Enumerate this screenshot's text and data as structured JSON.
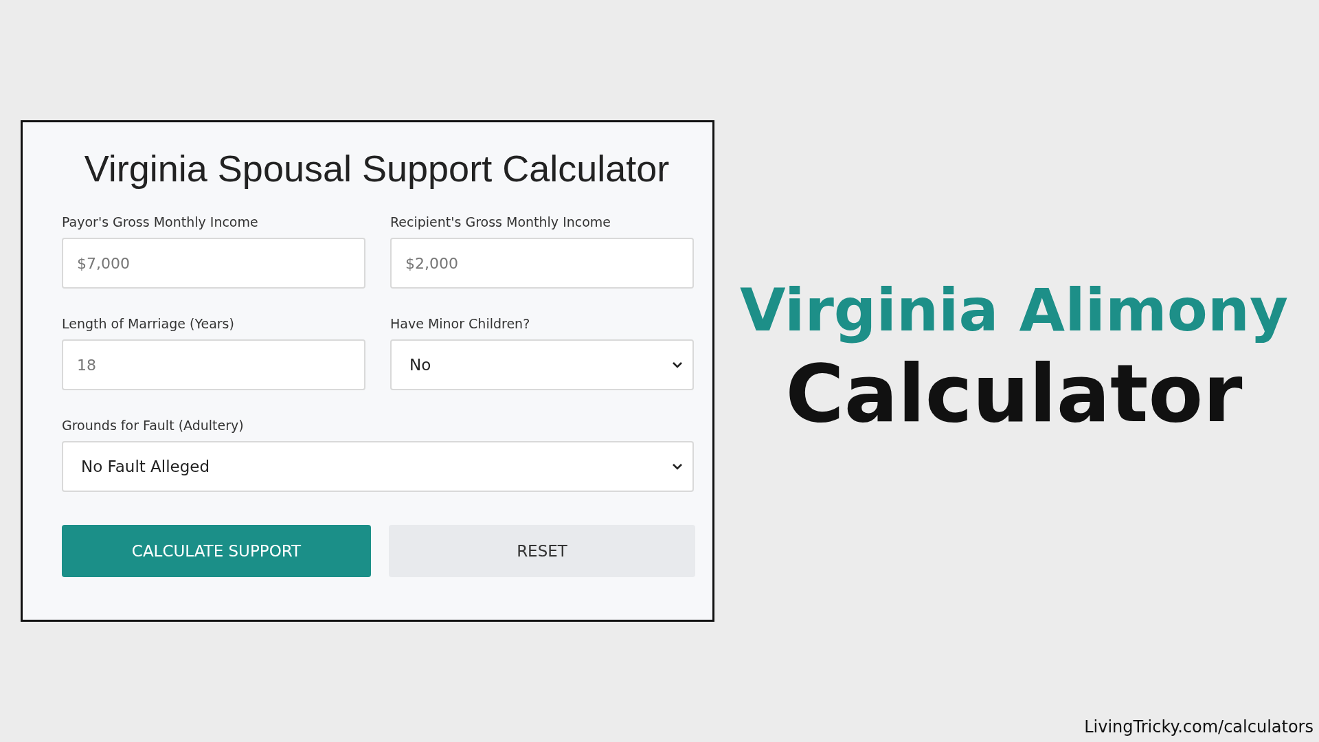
{
  "form": {
    "title": "Virginia Spousal Support Calculator",
    "rows": [
      [
        {
          "kind": "input",
          "label": "Payor's Gross Monthly Income",
          "placeholder": "$7,000"
        },
        {
          "kind": "input",
          "label": "Recipient's Gross Monthly Income",
          "placeholder": "$2,000"
        }
      ],
      [
        {
          "kind": "input",
          "label": "Length of Marriage (Years)",
          "placeholder": "18"
        },
        {
          "kind": "select",
          "label": "Have Minor Children?",
          "value": "No"
        }
      ],
      [
        {
          "kind": "select",
          "label": "Grounds for Fault (Adultery)",
          "value": "No Fault Alleged"
        }
      ]
    ],
    "buttons": [
      {
        "kind": "primary",
        "label": "CALCULATE SUPPORT"
      },
      {
        "kind": "secondary",
        "label": "RESET"
      }
    ]
  },
  "headline": {
    "line_1": "Virginia Alimony",
    "line_2": "Calculator"
  },
  "footer": "LivingTricky.com/calculators"
}
